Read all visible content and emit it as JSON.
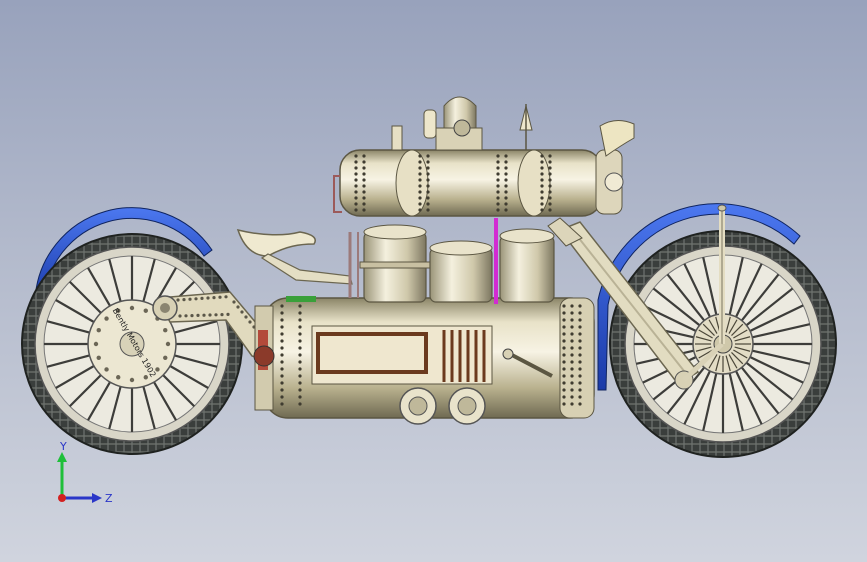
{
  "window": {
    "title": ""
  },
  "model": {
    "wheel_text": "Bently Motors 1902",
    "colors": {
      "tire": "#2e3130",
      "rim": "#e9e6d8",
      "fender": "#2a56d2",
      "brass": "#d8cfae",
      "frame": "#ddd6bc",
      "boiler": "#cfc7a6",
      "firebox": "#6b3a1e",
      "pipe_magenta": "#d22bd2"
    }
  },
  "triad": {
    "y_label": "Y",
    "z_label": "Z",
    "colors": {
      "y": "#1fbf3a",
      "z": "#2a36c8",
      "x": "#d32020"
    }
  }
}
